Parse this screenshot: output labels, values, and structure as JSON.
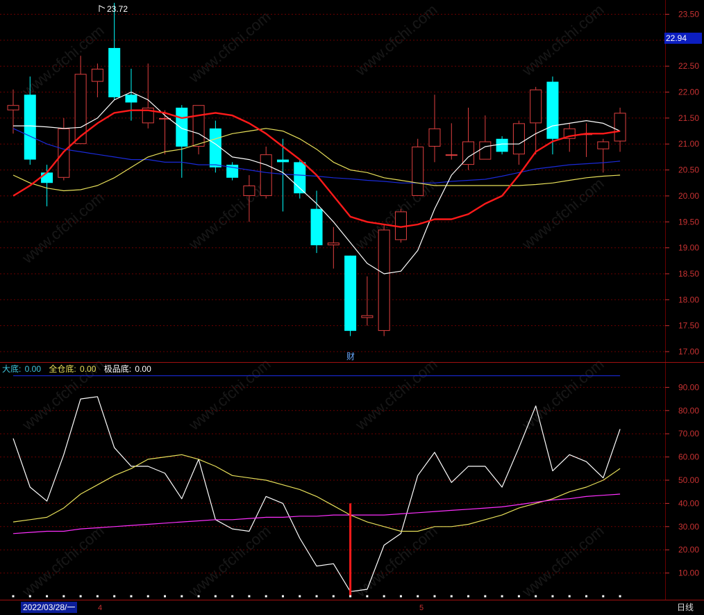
{
  "colors": {
    "background": "#000000",
    "grid": "#6a0000",
    "axis_text": "#c83232",
    "up_candle": "#e04040",
    "down_candle": "#00ffff",
    "ma_white": "#ffffff",
    "ma_red": "#ff1a1a",
    "ma_yellow": "#e8e05a",
    "ma_blue": "#1a2ad8",
    "ind_white": "#ffffff",
    "ind_yellow": "#e8e05a",
    "ind_magenta": "#ff30ff",
    "ind_blue": "#1a2ad8",
    "signal_bar": "#ff1a1a"
  },
  "price_badge": "22.94",
  "high_marker": "23.72",
  "event_marker": "财",
  "indicator_legend": [
    {
      "label": "大底: ",
      "value": "0.00",
      "color": "#40c8e0"
    },
    {
      "label": "全仓底: ",
      "value": "0.00",
      "color": "#e8e05a"
    },
    {
      "label": "极品底: ",
      "value": "0.00",
      "color": "#ffffff"
    }
  ],
  "date_label": "2022/03/28/一",
  "month_labels": [
    "4",
    "5"
  ],
  "period_button": "日线",
  "watermark": "www.cfchi.com",
  "chart_data": [
    {
      "type": "candlestick",
      "ylim": [
        16.9,
        23.75
      ],
      "yticks": [
        "17.00",
        "17.50",
        "18.00",
        "18.50",
        "19.00",
        "19.50",
        "20.00",
        "20.50",
        "21.00",
        "21.50",
        "22.00",
        "22.50",
        "23.00",
        "23.50"
      ],
      "candles": [
        {
          "o": 21.65,
          "c": 21.75,
          "h": 22.05,
          "l": 21.2
        },
        {
          "o": 21.95,
          "c": 20.7,
          "h": 22.3,
          "l": 20.6
        },
        {
          "o": 20.45,
          "c": 20.25,
          "h": 20.6,
          "l": 19.8
        },
        {
          "o": 20.35,
          "c": 21.3,
          "h": 21.5,
          "l": 20.3
        },
        {
          "o": 21.0,
          "c": 22.35,
          "h": 22.7,
          "l": 21.0
        },
        {
          "o": 22.2,
          "c": 22.45,
          "h": 22.55,
          "l": 21.9
        },
        {
          "o": 22.85,
          "c": 21.9,
          "h": 23.72,
          "l": 21.85
        },
        {
          "o": 21.95,
          "c": 21.8,
          "h": 22.45,
          "l": 21.45
        },
        {
          "o": 21.4,
          "c": 21.7,
          "h": 22.55,
          "l": 21.3
        },
        {
          "o": 21.5,
          "c": 21.5,
          "h": 21.65,
          "l": 20.8
        },
        {
          "o": 21.7,
          "c": 20.95,
          "h": 21.75,
          "l": 20.35
        },
        {
          "o": 20.95,
          "c": 21.75,
          "h": 21.75,
          "l": 20.8
        },
        {
          "o": 21.3,
          "c": 20.55,
          "h": 21.45,
          "l": 20.45
        },
        {
          "o": 20.6,
          "c": 20.35,
          "h": 20.65,
          "l": 20.3
        },
        {
          "o": 20.0,
          "c": 20.2,
          "h": 20.4,
          "l": 19.5
        },
        {
          "o": 20.0,
          "c": 20.8,
          "h": 20.95,
          "l": 19.95
        },
        {
          "o": 20.7,
          "c": 20.65,
          "h": 21.1,
          "l": 19.7
        },
        {
          "o": 20.65,
          "c": 20.05,
          "h": 20.7,
          "l": 19.95
        },
        {
          "o": 19.75,
          "c": 19.05,
          "h": 20.1,
          "l": 18.9
        },
        {
          "o": 19.05,
          "c": 19.1,
          "h": 19.4,
          "l": 18.6
        },
        {
          "o": 18.85,
          "c": 17.4,
          "h": 18.85,
          "l": 17.3
        },
        {
          "o": 17.65,
          "c": 17.7,
          "h": 18.45,
          "l": 17.5
        },
        {
          "o": 17.4,
          "c": 19.35,
          "h": 19.45,
          "l": 17.3
        },
        {
          "o": 19.15,
          "c": 19.7,
          "h": 19.75,
          "l": 19.1
        },
        {
          "o": 20.0,
          "c": 20.95,
          "h": 21.1,
          "l": 20.0
        },
        {
          "o": 20.95,
          "c": 21.3,
          "h": 21.95,
          "l": 20.65
        },
        {
          "o": 20.8,
          "c": 20.8,
          "h": 21.4,
          "l": 20.7
        },
        {
          "o": 20.6,
          "c": 21.05,
          "h": 21.7,
          "l": 20.5
        },
        {
          "o": 20.7,
          "c": 21.05,
          "h": 21.55,
          "l": 20.7
        },
        {
          "o": 21.1,
          "c": 20.85,
          "h": 21.15,
          "l": 20.8
        },
        {
          "o": 20.8,
          "c": 21.4,
          "h": 21.45,
          "l": 20.6
        },
        {
          "o": 21.4,
          "c": 22.05,
          "h": 22.1,
          "l": 20.8
        },
        {
          "o": 22.2,
          "c": 21.1,
          "h": 22.3,
          "l": 20.8
        },
        {
          "o": 21.1,
          "c": 21.3,
          "h": 21.4,
          "l": 20.85
        },
        {
          "o": 21.2,
          "c": 21.2,
          "h": 21.4,
          "l": 20.75
        },
        {
          "o": 20.9,
          "c": 21.05,
          "h": 21.1,
          "l": 20.45
        },
        {
          "o": 21.05,
          "c": 21.6,
          "h": 21.7,
          "l": 20.85
        }
      ],
      "ma_white": [
        21.35,
        21.35,
        21.33,
        21.3,
        21.32,
        21.5,
        21.85,
        22.0,
        21.85,
        21.55,
        21.3,
        21.2,
        21.0,
        20.75,
        20.7,
        20.6,
        20.45,
        20.15,
        19.85,
        19.5,
        19.1,
        18.7,
        18.5,
        18.55,
        18.95,
        19.75,
        20.4,
        20.75,
        20.95,
        21.0,
        21.0,
        21.2,
        21.35,
        21.4,
        21.45,
        21.4,
        21.25
      ],
      "ma_red": [
        20.0,
        20.2,
        20.45,
        20.85,
        21.15,
        21.4,
        21.6,
        21.65,
        21.65,
        21.6,
        21.5,
        21.55,
        21.6,
        21.55,
        21.4,
        21.2,
        20.95,
        20.7,
        20.4,
        20.0,
        19.6,
        19.5,
        19.45,
        19.4,
        19.45,
        19.55,
        19.55,
        19.65,
        19.85,
        20.0,
        20.4,
        20.85,
        21.05,
        21.15,
        21.2,
        21.2,
        21.25
      ],
      "ma_yellow": [
        20.4,
        20.25,
        20.15,
        20.1,
        20.12,
        20.2,
        20.35,
        20.55,
        20.75,
        20.85,
        20.9,
        21.0,
        21.1,
        21.2,
        21.25,
        21.3,
        21.25,
        21.1,
        20.9,
        20.65,
        20.5,
        20.45,
        20.35,
        20.3,
        20.25,
        20.2,
        20.2,
        20.2,
        20.2,
        20.2,
        20.2,
        20.22,
        20.25,
        20.3,
        20.35,
        20.38,
        20.4
      ],
      "ma_blue": [
        21.3,
        21.15,
        21.0,
        20.9,
        20.85,
        20.8,
        20.75,
        20.7,
        20.7,
        20.65,
        20.65,
        20.6,
        20.6,
        20.55,
        20.5,
        20.45,
        20.42,
        20.4,
        20.38,
        20.35,
        20.33,
        20.3,
        20.28,
        20.25,
        20.25,
        20.25,
        20.28,
        20.3,
        20.32,
        20.38,
        20.45,
        20.52,
        20.56,
        20.6,
        20.62,
        20.64,
        20.67
      ]
    },
    {
      "type": "line",
      "ylim": [
        0,
        100
      ],
      "yticks": [
        "10.00",
        "20.00",
        "30.00",
        "40.00",
        "50.00",
        "60.00",
        "70.00",
        "80.00",
        "90.00"
      ],
      "series": [
        {
          "values": [
            68,
            47,
            41,
            61,
            85,
            86,
            64,
            56,
            56,
            53,
            42,
            59,
            33,
            29,
            28,
            43,
            40,
            25,
            13,
            14,
            2,
            3,
            22,
            27,
            52,
            62,
            49,
            56,
            56,
            47,
            64,
            82,
            54,
            61,
            58,
            51,
            72
          ]
        },
        {
          "values": [
            32,
            33,
            34,
            38,
            44,
            48,
            52,
            55,
            59,
            60,
            61,
            59,
            56,
            52,
            51,
            50,
            48,
            46,
            43,
            39,
            35,
            32,
            30,
            28,
            28,
            30,
            30,
            31,
            33,
            35,
            38,
            40,
            42,
            45,
            47,
            50,
            55
          ]
        },
        {
          "values": [
            27,
            27.5,
            28,
            28,
            29,
            29.5,
            30,
            30.5,
            31,
            31.5,
            32,
            32.5,
            33,
            33,
            33.5,
            34,
            34,
            34.5,
            34.5,
            35,
            35,
            35,
            35,
            35.5,
            36,
            36.5,
            37,
            37.5,
            38,
            38.5,
            39.5,
            40.5,
            41.5,
            42,
            43,
            43.5,
            44
          ]
        },
        {
          "values": [
            95,
            95,
            95,
            95,
            95,
            95,
            95,
            95,
            95,
            95,
            95,
            95,
            95,
            95,
            95,
            95,
            95,
            95,
            95,
            95,
            95,
            95,
            95,
            95,
            95,
            95,
            95,
            95,
            95,
            95,
            95,
            95,
            95,
            95,
            95,
            95,
            95
          ]
        }
      ],
      "signal_bars": [
        {
          "index": 20,
          "value": 40
        }
      ]
    }
  ]
}
